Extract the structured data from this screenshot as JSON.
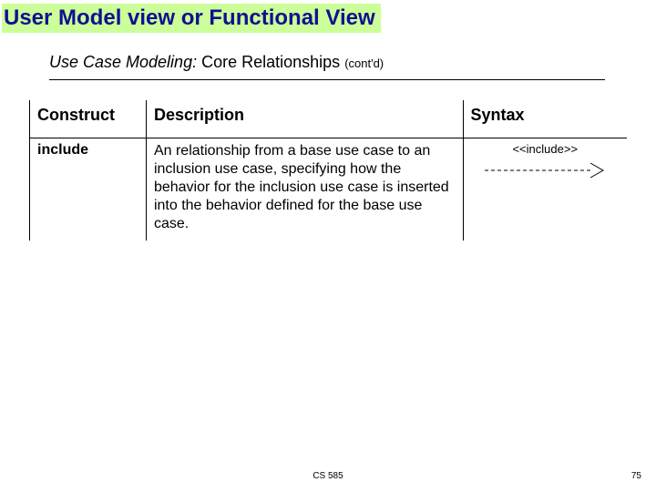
{
  "title": "User Model view or Functional View",
  "subtitle": {
    "italic": "Use Case Modeling:",
    "rest": " Core Relationships ",
    "small": "(cont'd)"
  },
  "headers": {
    "construct": "Construct",
    "description": "Description",
    "syntax": "Syntax"
  },
  "row": {
    "construct": "include",
    "description": "An relationship from a base use case to an inclusion use case, specifying how the behavior for the inclusion use case is inserted into the behavior defined for the base use case.",
    "stereotype": "<<include>>"
  },
  "footer": {
    "course": "CS 585",
    "page": "75"
  }
}
